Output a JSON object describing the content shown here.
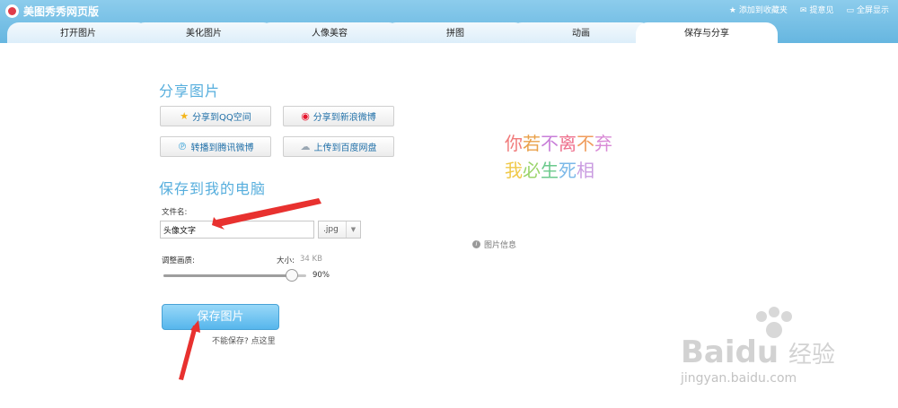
{
  "window": {
    "title": "美图秀秀网页版"
  },
  "top_links": [
    {
      "icon": "star-icon",
      "label": "添加到收藏夹"
    },
    {
      "icon": "feedback-icon",
      "label": "提意见"
    },
    {
      "icon": "fullscreen-icon",
      "label": "全屏显示"
    }
  ],
  "tabs": [
    {
      "label": "打开图片",
      "active": false
    },
    {
      "label": "美化图片",
      "active": false
    },
    {
      "label": "人像美容",
      "active": false
    },
    {
      "label": "拼图",
      "active": false
    },
    {
      "label": "动画",
      "active": false
    },
    {
      "label": "保存与分享",
      "active": true
    }
  ],
  "share": {
    "title": "分享图片",
    "buttons": [
      {
        "icon": "qzone-star-icon",
        "label": "分享到QQ空间"
      },
      {
        "icon": "sina-weibo-icon",
        "label": "分享到新浪微博"
      },
      {
        "icon": "tencent-weibo-icon",
        "label": "转播到腾讯微博"
      },
      {
        "icon": "baidu-cloud-icon",
        "label": "上传到百度网盘"
      }
    ]
  },
  "save_local": {
    "title": "保存到我的电脑",
    "filename_label": "文件名:",
    "filename_value": "头像文字",
    "format": ".jpg",
    "quality_label": "调整画质:",
    "size_label": "大小:",
    "size_value": "34 KB",
    "quality_value": 0.9,
    "quality_text": "90%",
    "save_button": "保存图片",
    "cant_save_link": "不能保存? 点这里"
  },
  "preview": {
    "line1": "你若不离不弃",
    "line2": "我必生死相",
    "line1_colors": [
      "#f07a7a",
      "#e9a14b",
      "#c87ed8",
      "#ee6f8c",
      "#f09c5c",
      "#d98bd6"
    ],
    "line2_colors": [
      "#f0c94a",
      "#9bd46b",
      "#6bc98c",
      "#7ab8e8",
      "#c99be0"
    ],
    "info_label": "图片信息"
  },
  "watermark": {
    "brand_text": "Baidu",
    "brand_cn": "经验",
    "url": "jingyan.baidu.com"
  },
  "colors": {
    "accent": "#56aedd",
    "topbar": "#66b6e0",
    "annotation_arrow": "#e8312f"
  }
}
